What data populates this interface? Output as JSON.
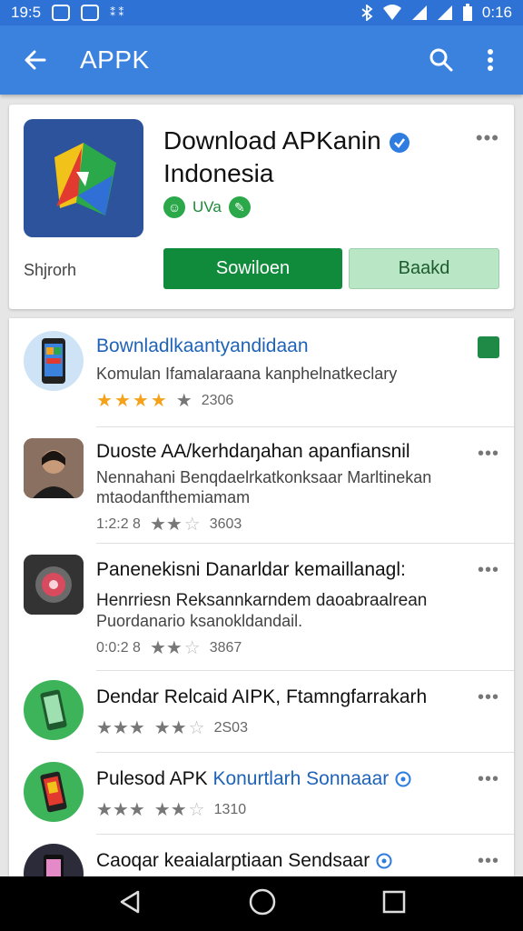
{
  "status_bar": {
    "time": "19:5",
    "extra": "⁑ ⁑",
    "clock": "0:16"
  },
  "app_bar": {
    "title": "APPK",
    "back_icon": "arrow-left-icon",
    "search_icon": "search-icon",
    "menu_icon": "more-vert-icon"
  },
  "hero": {
    "title_line1": "Download APKanin",
    "title_line2": "Indonesia",
    "tag_label": "UVa",
    "caption": "Shjrorh",
    "primary_button": "Sowiloen",
    "secondary_button": "Baakd",
    "icon_color": "#2d539c"
  },
  "list": [
    {
      "title": "Bownladlkaantyandidaan",
      "subtitle": "Komulan Ifamalaraana kanphelnatkeclary",
      "rating": 4,
      "count": "2306",
      "title_color": "blue"
    },
    {
      "title": "Duoste AA/kerhdaŋahan apanfiansnil",
      "subtitle": "Nennahani Benqdaelrkatkonksaar Marltinekan",
      "subtitle2": "mtaodanfthemiamam",
      "meta_left": "1:2:2 8",
      "count": "3603"
    },
    {
      "title": "Panenekisni Danarldar kemaillanagl:",
      "subtitle": "Henrriesn Reksannkarndem daoabraalrean",
      "subtitle2": "Puordanario ksanokldandail.",
      "meta_left": "0:0:2 8",
      "count": "3867"
    },
    {
      "title": "Dendar Relcaid AIPK, Ftamngfarrakarh",
      "meta_left": "★★★",
      "count": "2S03"
    },
    {
      "title": "Pulesod APK",
      "title_blue_suffix": "Konurtlarh Sonnaaar",
      "meta_left": "★★★",
      "count": "1310"
    },
    {
      "title": "Caoqar keaialarptiaan Sendsaar"
    }
  ]
}
